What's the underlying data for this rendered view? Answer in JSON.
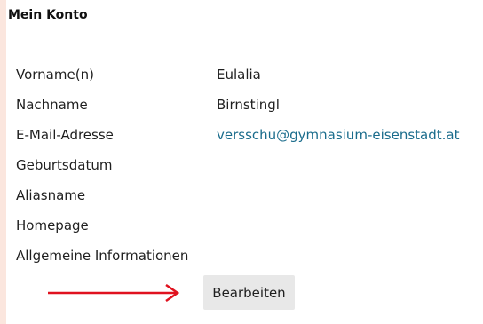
{
  "section": {
    "title": "Mein Konto"
  },
  "profile": {
    "rows": [
      {
        "label": "Vorname(n)",
        "value": "Eulalia"
      },
      {
        "label": "Nachname",
        "value": "Birnstingl"
      },
      {
        "label": "E-Mail-Adresse",
        "value": "versschu@gymnasium-eisenstadt.at"
      },
      {
        "label": "Geburtsdatum",
        "value": ""
      },
      {
        "label": "Aliasname",
        "value": ""
      },
      {
        "label": "Homepage",
        "value": ""
      },
      {
        "label": "Allgemeine Informationen",
        "value": ""
      }
    ]
  },
  "actions": {
    "edit_label": "Bearbeiten"
  },
  "colors": {
    "accent_stripe": "#fbe6de",
    "link": "#1a6c8c",
    "arrow": "#e0121f",
    "button_bg": "#e8e8e8"
  },
  "icons": {
    "pointer": "arrow-right-icon"
  }
}
